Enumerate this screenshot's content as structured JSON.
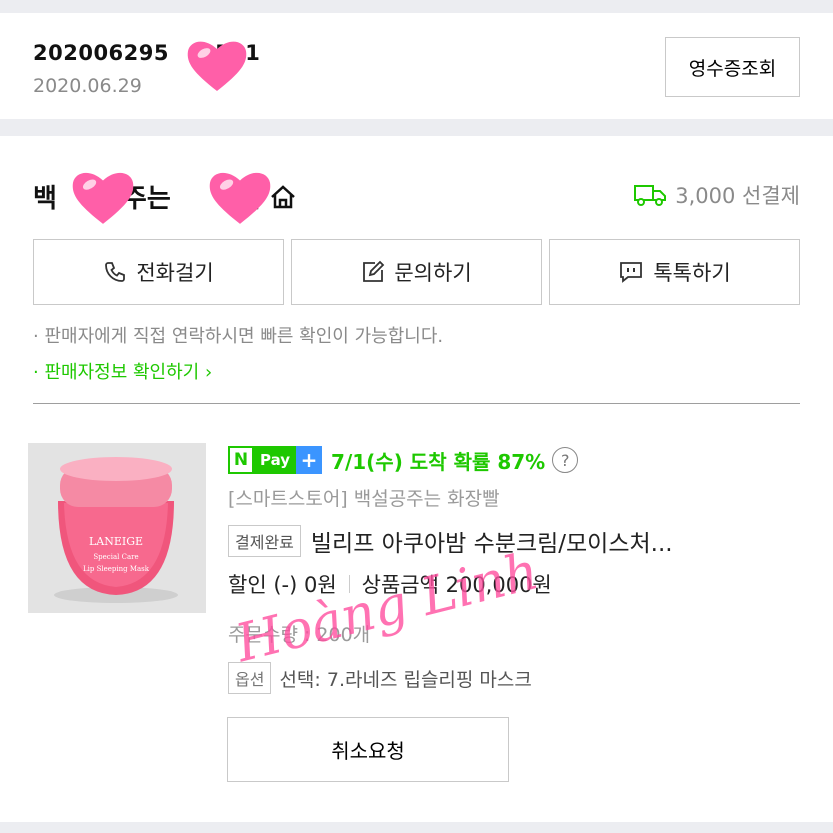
{
  "order": {
    "number": "202006295",
    "number_suffix": "531",
    "date": "2020.06.29",
    "receipt_label": "영수증조회"
  },
  "seller": {
    "name_start": "백",
    "name_mid": "주는",
    "name_end": "빨",
    "shipping_text": "3,000 선결제",
    "actions": {
      "call_label": "전화걸기",
      "inquiry_label": "문의하기",
      "talk_label": "톡톡하기"
    },
    "notice": "판매자에게 직접 연락하시면 빠른 확인이 가능합니다.",
    "info_link": "판매자정보 확인하기"
  },
  "product": {
    "pay_n": "N",
    "pay_label": "Pay",
    "pay_plus": "+",
    "arrival": "7/1(수) 도착 확률 87%",
    "help": "?",
    "store": "[스마트스토어] 백설공주는 화장빨",
    "status": "결제완료",
    "title": "빌리프 아쿠아밤 수분크림/모이스처...",
    "discount": "할인 (-) 0원",
    "price": "상품금액 200,000원",
    "quantity": "주문수량 : 200개",
    "option_tag": "옵션",
    "option_text": "선택: 7.라네즈 립슬리핑 마스크",
    "image_brand": "LANEIGE",
    "image_line1": "Special Care",
    "image_line2": "Lip Sleeping Mask",
    "cancel_label": "취소요청"
  },
  "watermark": "Hoàng Linh",
  "colors": {
    "green": "#1ec800",
    "blue": "#3b95ff",
    "pink": "#ff4fa0"
  }
}
